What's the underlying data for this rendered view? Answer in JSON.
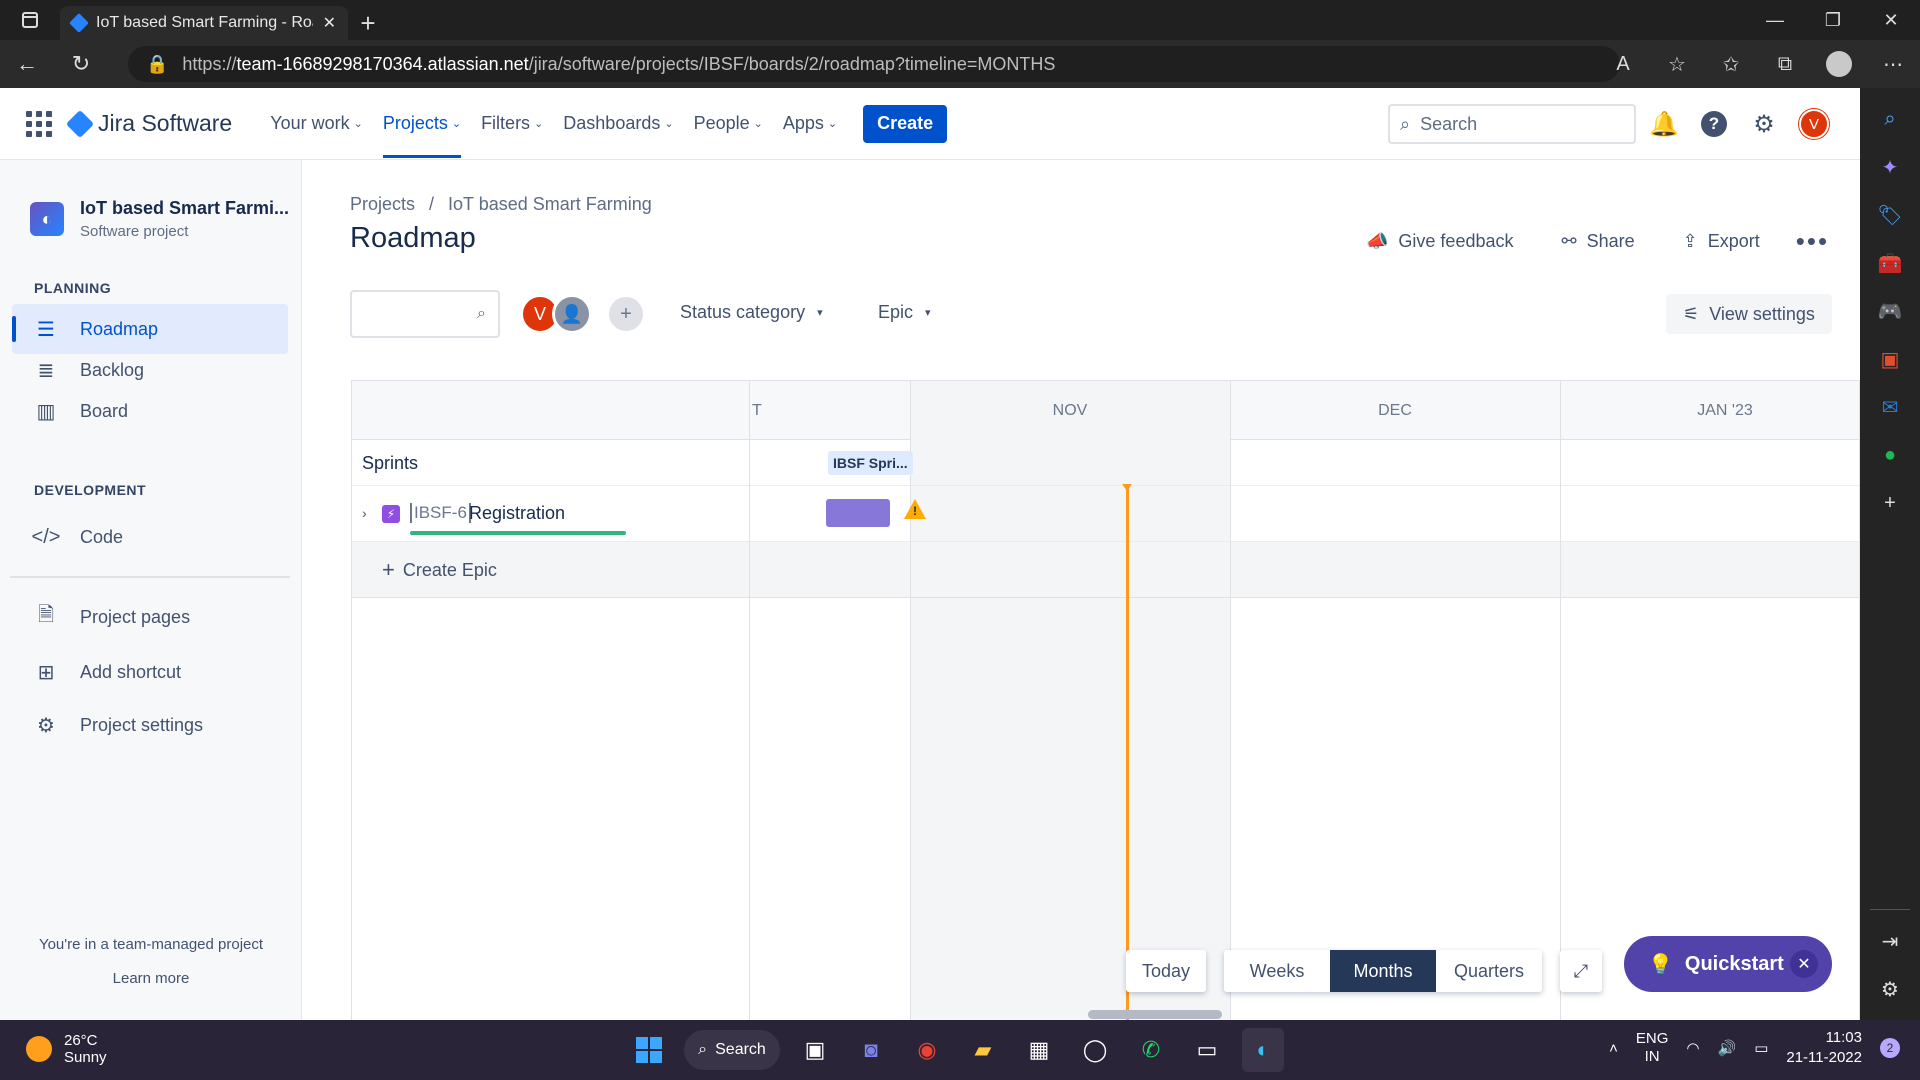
{
  "browser": {
    "tab_title": "IoT based Smart Farming - Roadm",
    "url_prefix": "https://",
    "url_host": "team-16689298170364.atlassian.net",
    "url_path": "/jira/software/projects/IBSF/boards/2/roadmap?timeline=MONTHS"
  },
  "jira_nav": {
    "product": "Jira Software",
    "items": [
      "Your work",
      "Projects",
      "Filters",
      "Dashboards",
      "People",
      "Apps"
    ],
    "create_label": "Create",
    "search_placeholder": "Search",
    "avatar_initial": "V"
  },
  "sidebar": {
    "project_name": "IoT based Smart Farmi...",
    "project_type": "Software project",
    "planning_heading": "PLANNING",
    "planning_items": [
      "Roadmap",
      "Backlog",
      "Board"
    ],
    "development_heading": "DEVELOPMENT",
    "development_items": [
      "Code"
    ],
    "other_items": [
      "Project pages",
      "Add shortcut",
      "Project settings"
    ],
    "footer_text": "You're in a team-managed project",
    "learn_more": "Learn more"
  },
  "main": {
    "breadcrumb": [
      "Projects",
      "/",
      "IoT based Smart Farming"
    ],
    "title": "Roadmap",
    "actions": [
      "Give feedback",
      "Share",
      "Export"
    ],
    "filters": {
      "avatar_initial": "V",
      "status_category": "Status category",
      "epic": "Epic",
      "view_settings": "View settings"
    }
  },
  "timeline": {
    "months": [
      "T",
      "NOV",
      "DEC",
      "JAN '23"
    ],
    "sprints_label": "Sprints",
    "sprint_chip": "IBSF Spri...",
    "epic": {
      "key": "IBSF-6",
      "summary": "Registration",
      "color": "#8777d9"
    },
    "create_epic": "Create Epic",
    "today_label": "Today",
    "scales": [
      "Weeks",
      "Months",
      "Quarters"
    ],
    "active_scale": "Months",
    "quickstart": "Quickstart"
  },
  "taskbar": {
    "temperature": "26°C",
    "weather": "Sunny",
    "search_label": "Search",
    "lang_top": "ENG",
    "lang_bottom": "IN",
    "time": "11:03",
    "date": "21-11-2022",
    "notification_count": "2"
  }
}
